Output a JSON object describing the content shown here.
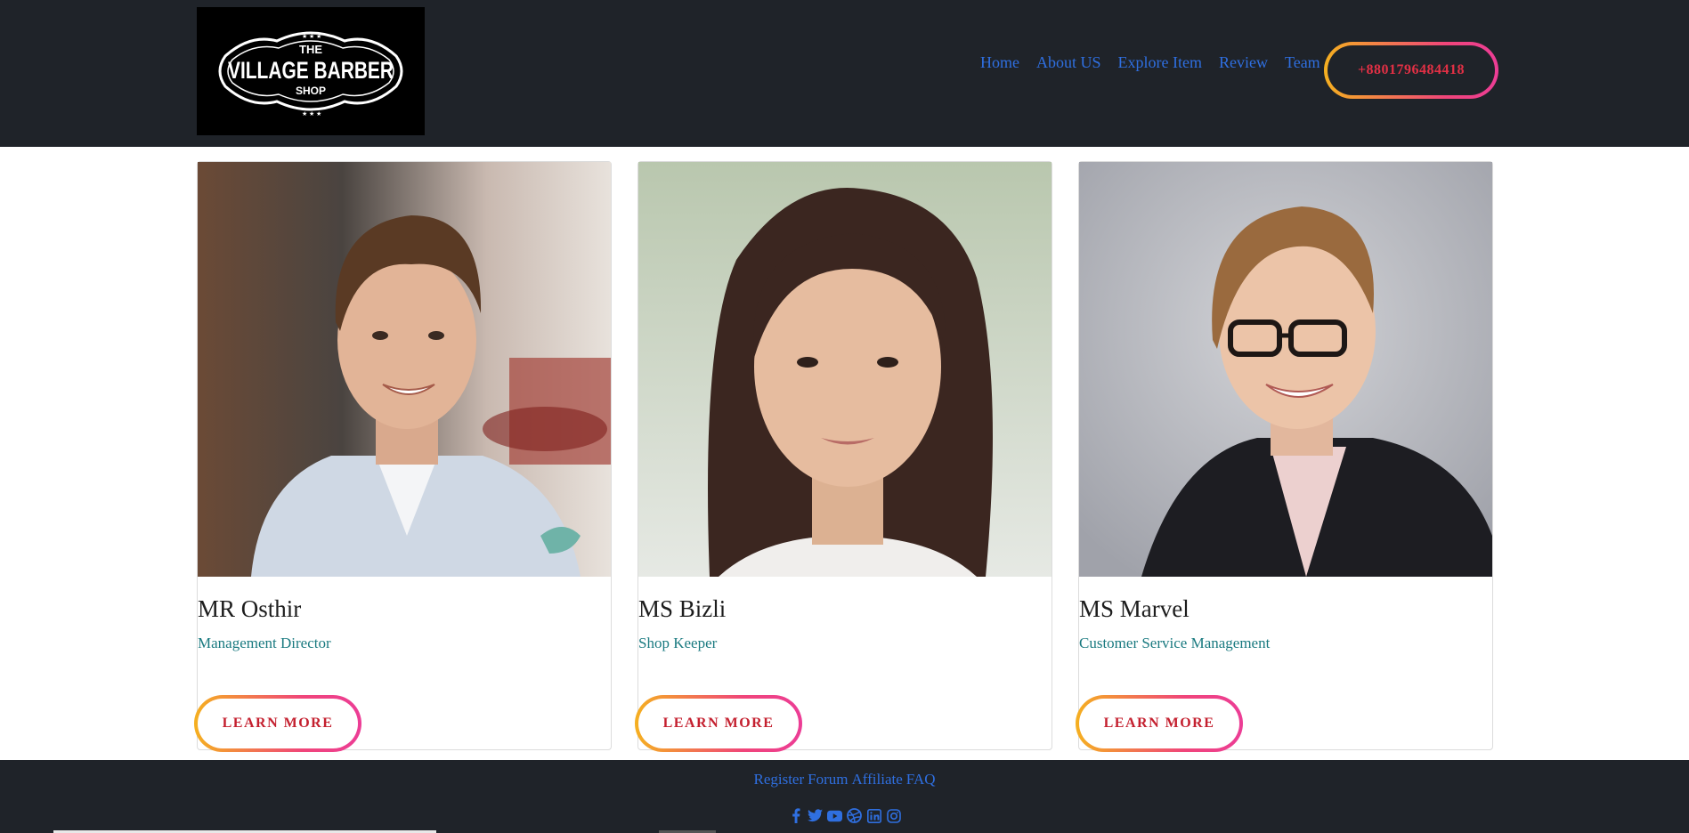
{
  "logo": {
    "line1": "THE",
    "line2": "VILLAGE BARBER",
    "line3": "SHOP"
  },
  "nav": {
    "items": [
      "Home",
      "About US",
      "Explore Item",
      "Review",
      "Team"
    ]
  },
  "phone": "+8801796484418",
  "team": [
    {
      "name": "MR Osthir",
      "role": "Management Director",
      "button": "LEARN MORE"
    },
    {
      "name": "MS Bizli",
      "role": "Shop Keeper",
      "button": "LEARN MORE"
    },
    {
      "name": "MS Marvel",
      "role": "Customer Service Management",
      "button": "LEARN MORE"
    }
  ],
  "footer": {
    "links": [
      "Register",
      "Forum",
      "Affiliate",
      "FAQ"
    ],
    "socials": [
      "facebook-icon",
      "twitter-icon",
      "youtube-icon",
      "dribbble-icon",
      "linkedin-icon",
      "instagram-icon"
    ]
  },
  "colors": {
    "header_bg": "#1f2329",
    "link": "#2f6fe0",
    "accent_red": "#c4202f",
    "role_teal": "#1a7a80",
    "gradient_start": "#f5b020",
    "gradient_end": "#ec3d96"
  }
}
